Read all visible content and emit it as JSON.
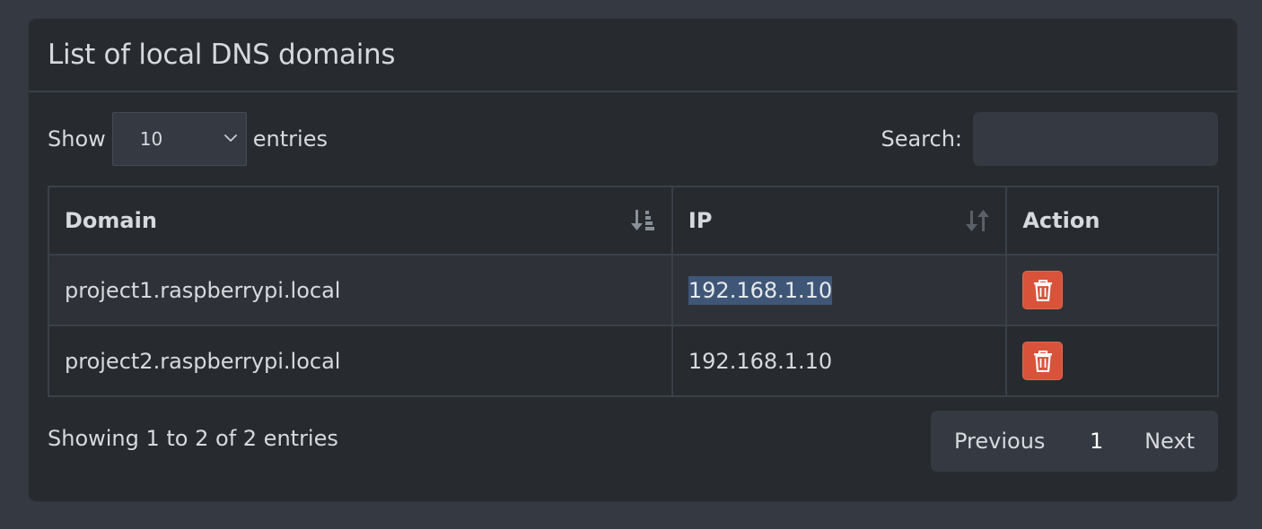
{
  "panel": {
    "title": "List of local DNS domains"
  },
  "length_menu": {
    "show_label": "Show",
    "selected": "10",
    "entries_label": "entries"
  },
  "search": {
    "label": "Search:",
    "value": "",
    "placeholder": ""
  },
  "table": {
    "columns": [
      "Domain",
      "IP",
      "Action"
    ],
    "rows": [
      {
        "domain": "project1.raspberrypi.local",
        "ip": "192.168.1.10"
      },
      {
        "domain": "project2.raspberrypi.local",
        "ip": "192.168.1.10"
      }
    ],
    "sort": {
      "column": "Domain",
      "direction": "ascending"
    },
    "delete_icon": "trash-icon",
    "colors": {
      "delete_button": "#d9523a",
      "selection_highlight": "#3f5677"
    }
  },
  "footer": {
    "info": "Showing 1 to 2 of 2 entries"
  },
  "pagination": {
    "previous": "Previous",
    "current_page": "1",
    "next": "Next"
  }
}
